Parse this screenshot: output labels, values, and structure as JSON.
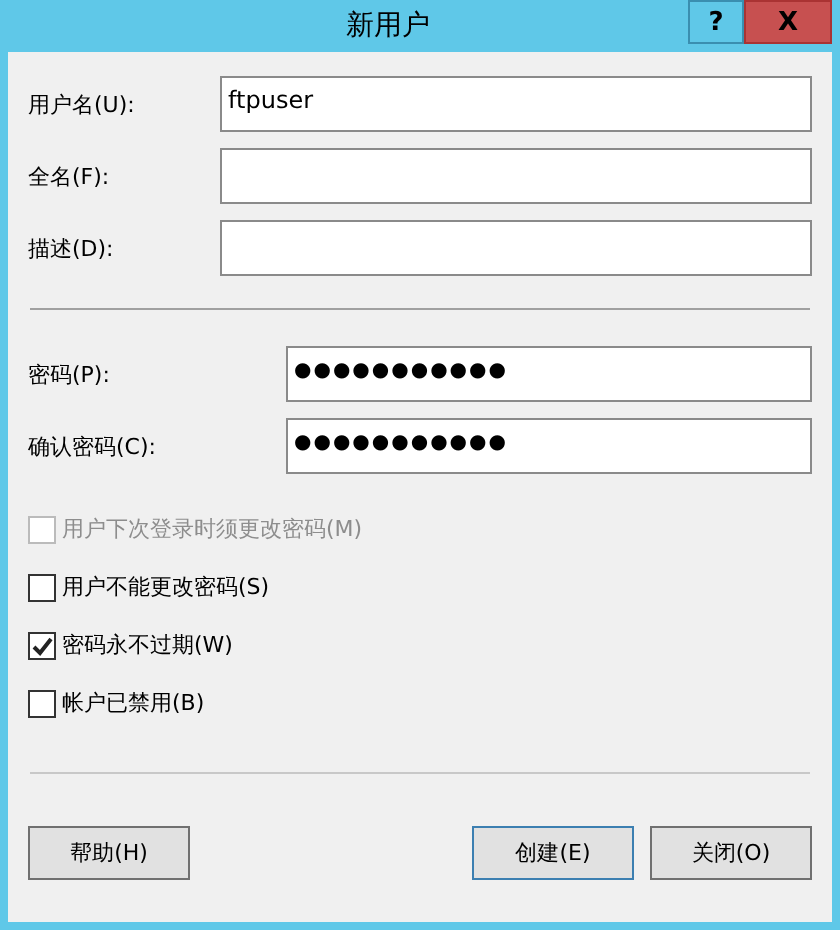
{
  "window": {
    "title": "新用户",
    "help_button": "?",
    "close_button": "X"
  },
  "fields": [
    {
      "label": "用户名(U):",
      "value": "ftpuser"
    },
    {
      "label": "全名(F):"
    },
    {
      "label": "描述(D):"
    }
  ],
  "password_fields": [
    {
      "label": "密码(P):",
      "value": "●●●●●●●●●●●"
    },
    {
      "label": "确认密码(C):",
      "value": "●●●●●●●●●●●"
    }
  ],
  "options": [
    {
      "label": "用户下次登录时须更改密码(M)",
      "checked": false,
      "disabled": true
    },
    {
      "label": "用户不能更改密码(S)",
      "checked": false,
      "disabled": false
    },
    {
      "label": "密码永不过期(W)",
      "checked": true,
      "disabled": false
    },
    {
      "label": "帐户已禁用(B)",
      "checked": false,
      "disabled": false
    }
  ],
  "buttons": {
    "help": "帮助(H)",
    "create": "创建(E)",
    "close": "关闭(O)"
  }
}
